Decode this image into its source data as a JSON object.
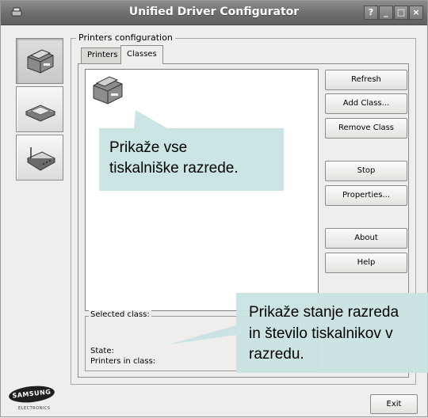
{
  "window": {
    "title": "Unified Driver Configurator",
    "controls": [
      "?",
      "_",
      "□",
      "×"
    ]
  },
  "group": {
    "legend": "Printers configuration"
  },
  "tabs": [
    {
      "label": "Printers",
      "active": false
    },
    {
      "label": "Classes",
      "active": true
    }
  ],
  "buttons": {
    "refresh": "Refresh",
    "add_class": "Add Class...",
    "remove_class": "Remove Class",
    "stop": "Stop",
    "properties": "Properties...",
    "about": "About",
    "help": "Help",
    "exit": "Exit"
  },
  "selected_class": {
    "legend": "Selected class:",
    "state_label": "State:",
    "printers_label": "Printers in class:"
  },
  "callouts": {
    "top_line1": "Prikaže vse",
    "top_line2": "tiskalniške razrede.",
    "bottom_line1": "Prikaže stanje razreda",
    "bottom_line2": "in število tiskalnikov v",
    "bottom_line3": "razredu."
  },
  "logo": {
    "brand": "SAMSUNG",
    "sub": "ELECTRONICS"
  },
  "colors": {
    "callout_fill": "#c8e3e3",
    "titlebar": "#6f6f6f"
  }
}
